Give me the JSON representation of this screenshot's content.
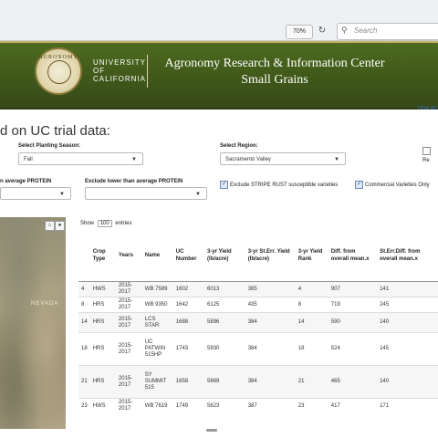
{
  "browser": {
    "zoom": "70%",
    "search_placeholder": "Search"
  },
  "banner": {
    "seal_text": "AGRONOMY",
    "uc_line1": "UNIVERSITY",
    "uc_line2": "OF",
    "uc_line3": "CALIFORNIA",
    "title_line1": "Agronomy Research & Information Center",
    "title_line2": "Small Grains"
  },
  "how_link": "How do",
  "headline": "d on UC trial data:",
  "filters": {
    "planting_label": "Select Planting Season:",
    "planting_value": "Fall",
    "region_label": "Select Region:",
    "region_value": "Sacramento Valley",
    "right_checkbox": "Re",
    "protein_label": "n average PROTEIN",
    "exclude_protein_label": "Exclude lower than average PROTEIN",
    "stripe_rust": "Exclude STRIPE RUST susceptible varieties",
    "commercial": "Commercial Varieties Only"
  },
  "map": {
    "state_label": "NEVADA"
  },
  "table": {
    "show_prefix": "Show",
    "show_value": "100",
    "show_suffix": "entries",
    "headers": [
      "",
      "Crop Type",
      "Years",
      "Name",
      "UC Number",
      "3-yr Yield (lb/acre)",
      "3-yr St.Err. Yield (lb/acre)",
      "3-yr Yield Rank",
      "Diff. from overall mean.x",
      "St.Err.Diff. from overall mean.x"
    ],
    "rows": [
      [
        "4",
        "HWS",
        "2015-2017",
        "WB 7589",
        "1602",
        "6013",
        "385",
        "4",
        "907",
        "141"
      ],
      [
        "8",
        "HRS",
        "2015-2017",
        "WB 9350",
        "1642",
        "6125",
        "435",
        "8",
        "719",
        "245"
      ],
      [
        "14",
        "HRS",
        "2015-2017",
        "LCS STAR",
        "1688",
        "5896",
        "384",
        "14",
        "590",
        "140"
      ],
      [
        "18",
        "HRS",
        "2015-2017",
        "UC PATWIN 515HP",
        "1743",
        "5930",
        "384",
        "18",
        "524",
        "145"
      ],
      [
        "21",
        "HRS",
        "2015-2017",
        "SY SUMMIT 515",
        "1658",
        "5669",
        "384",
        "21",
        "465",
        "140"
      ],
      [
        "23",
        "HWS",
        "2015-2017",
        "WB 7619",
        "1749",
        "5623",
        "387",
        "23",
        "417",
        "171"
      ]
    ]
  }
}
